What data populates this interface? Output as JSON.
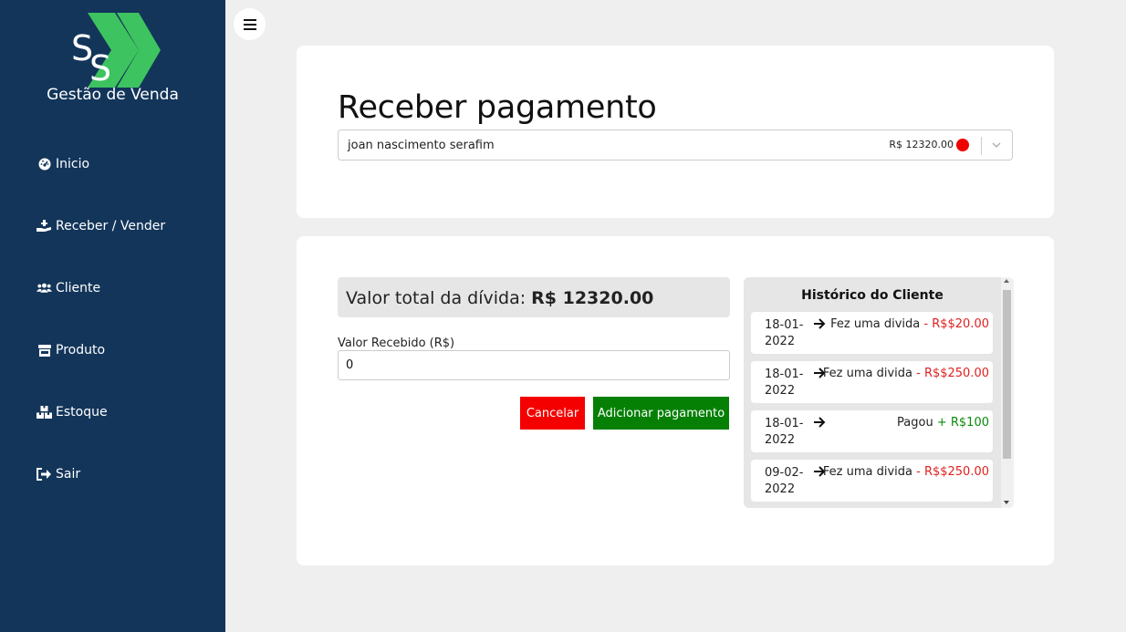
{
  "app": {
    "logo_initials": "SS",
    "logo_text": "Gestão de Venda"
  },
  "sidebar": {
    "items": [
      {
        "label": "Inicio",
        "icon": "dashboard-icon"
      },
      {
        "label": "Receber / Vender",
        "icon": "hand-holding-icon"
      },
      {
        "label": "Cliente",
        "icon": "users-icon"
      },
      {
        "label": "Produto",
        "icon": "store-icon"
      },
      {
        "label": "Estoque",
        "icon": "boxes-icon"
      },
      {
        "label": "Sair",
        "icon": "sign-out-icon"
      }
    ]
  },
  "page": {
    "title": "Receber pagamento"
  },
  "client_select": {
    "name": "joan nascimento serafim",
    "amount": "R$ 12320.00",
    "status_color": "#f00000"
  },
  "payment": {
    "debt_label": "Valor total da dívida: ",
    "debt_value": "R$ 12320.00",
    "received_label": "Valor Recebido (R$)",
    "received_value": "0",
    "cancel_label": "Cancelar",
    "add_label": "Adicionar pagamento"
  },
  "history": {
    "title": "Histórico do Cliente",
    "items": [
      {
        "date": "18-01-2022",
        "action": "Fez uma divida",
        "sign": " - ",
        "amount": "R$$20.00",
        "type": "neg"
      },
      {
        "date": "18-01-2022",
        "action": "Fez uma divida",
        "sign": " - ",
        "amount": "R$$250.00",
        "type": "neg"
      },
      {
        "date": "18-01-2022",
        "action": "Pagou",
        "sign": " + ",
        "amount": "R$100",
        "type": "pos"
      },
      {
        "date": "09-02-2022",
        "action": "Fez uma divida",
        "sign": " - ",
        "amount": "R$$250.00",
        "type": "neg"
      }
    ]
  },
  "colors": {
    "sidebar_bg": "#13355a",
    "logo_green": "#3dc35f",
    "cancel": "#f40000",
    "add": "#058005",
    "negative": "#e02020",
    "positive": "#0a8a0a"
  }
}
